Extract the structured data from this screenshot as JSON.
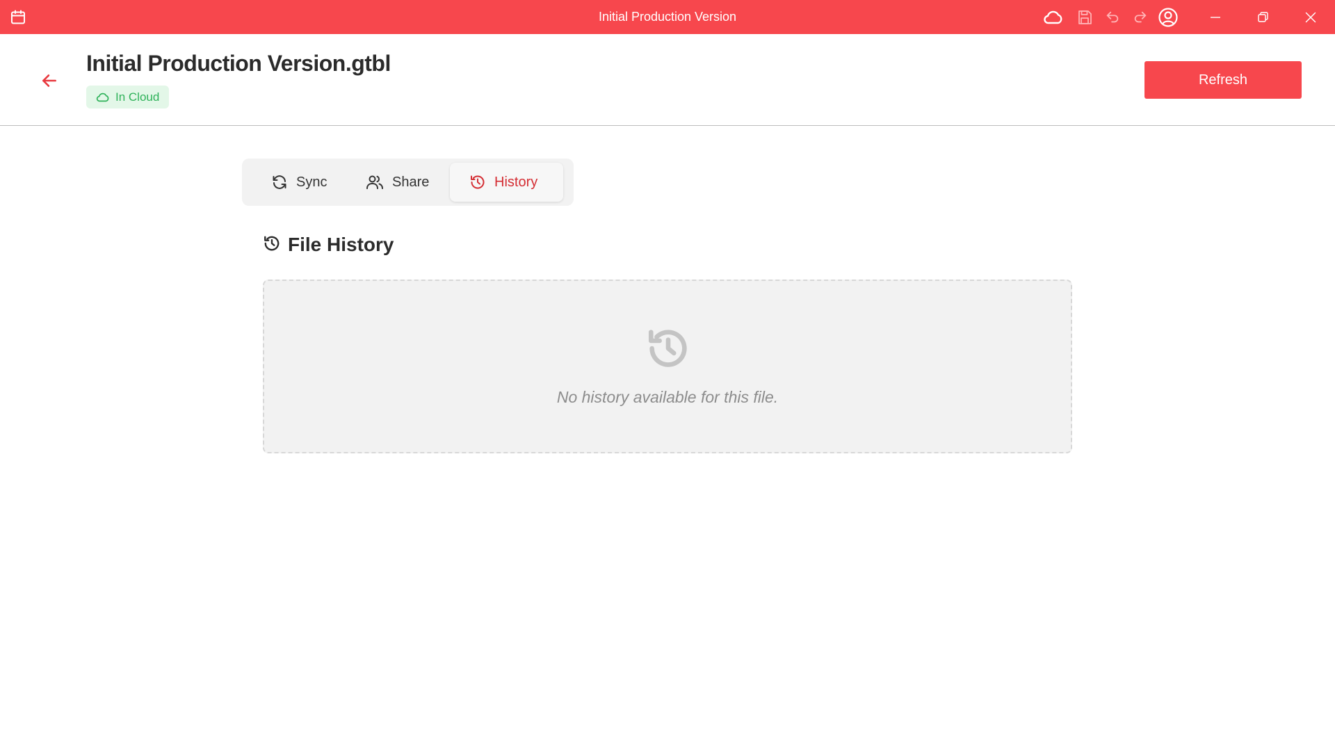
{
  "window": {
    "title": "Initial Production Version",
    "icons": [
      "calendar-icon",
      "cloud-icon",
      "save-icon",
      "undo-icon",
      "redo-icon",
      "account-icon",
      "minimize-icon",
      "restore-icon",
      "close-icon"
    ]
  },
  "header": {
    "file_name": "Initial Production Version.gtbl",
    "status_badge": "In Cloud",
    "refresh_label": "Refresh"
  },
  "tabs": [
    {
      "label": "Sync",
      "icon": "sync-icon",
      "active": false
    },
    {
      "label": "Share",
      "icon": "users-icon",
      "active": false
    },
    {
      "label": "History",
      "icon": "history-icon",
      "active": true
    }
  ],
  "history": {
    "title": "File History",
    "empty_message": "No history available for this file."
  },
  "colors": {
    "accent": "#f7474d",
    "accent_dark": "#d42d33",
    "badge_bg": "#e3f7e8",
    "badge_text": "#2fb25a",
    "empty_bg": "#f2f2f2",
    "muted_text": "#8c8c8c"
  }
}
